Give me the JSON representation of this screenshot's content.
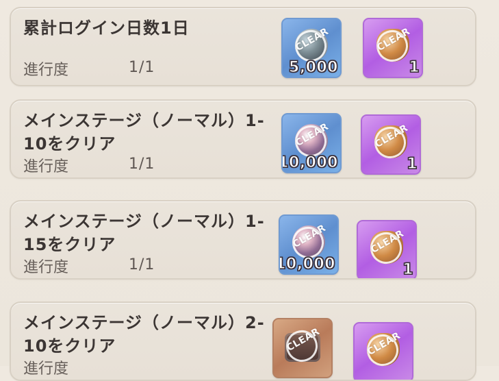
{
  "missions": [
    {
      "title": "累計ログイン日数1日",
      "progress_label": "進行度",
      "progress_value": "1/1",
      "rewards": [
        {
          "quantity": "5,000",
          "badge": "CLEAR"
        },
        {
          "quantity": "1",
          "badge": "CLEAR"
        }
      ]
    },
    {
      "title": "メインステージ（ノーマル）1-\n10をクリア",
      "progress_label": "進行度",
      "progress_value": "1/1",
      "rewards": [
        {
          "quantity": "10,000",
          "badge": "CLEAR"
        },
        {
          "quantity": "1",
          "badge": "CLEAR"
        }
      ]
    },
    {
      "title": "メインステージ（ノーマル）1-\n15をクリア",
      "progress_label": "進行度",
      "progress_value": "1/1",
      "rewards": [
        {
          "quantity": "10,000",
          "badge": "CLEAR"
        },
        {
          "quantity": "1",
          "badge": "CLEAR"
        }
      ]
    },
    {
      "title": "メインステージ（ノーマル）2-\n10をクリア",
      "progress_label": "進行度",
      "progress_value": "",
      "rewards": [
        {
          "quantity": "",
          "badge": "CLEAR"
        },
        {
          "quantity": "",
          "badge": "CLEAR"
        }
      ]
    }
  ]
}
